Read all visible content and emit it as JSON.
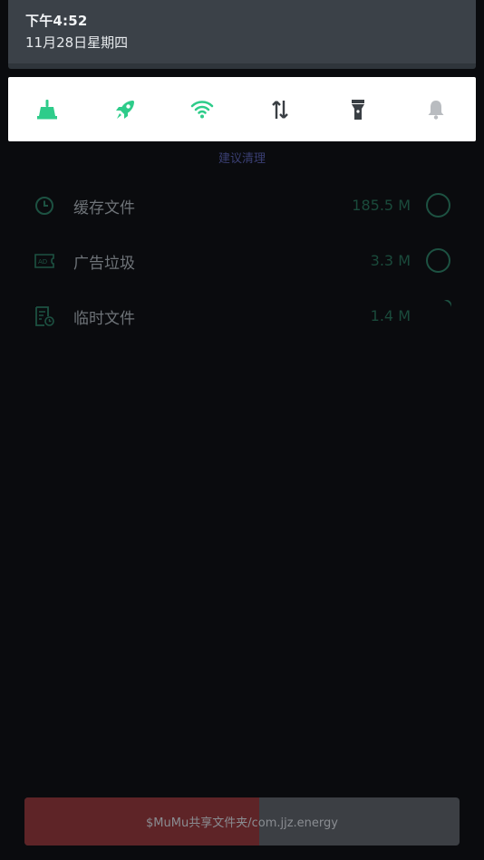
{
  "status": {
    "time": "下午4:52",
    "date": "11月28日星期四"
  },
  "quick_toggles": [
    {
      "name": "clean",
      "icon": "broom-icon",
      "color": "#2ecc8a"
    },
    {
      "name": "boost",
      "icon": "rocket-icon",
      "color": "#2ecc8a"
    },
    {
      "name": "wifi",
      "icon": "wifi-icon",
      "color": "#2ecc8a"
    },
    {
      "name": "data",
      "icon": "data-transfer-icon",
      "color": "#3a3f44"
    },
    {
      "name": "flashlight",
      "icon": "flashlight-icon",
      "color": "#3a3f44"
    },
    {
      "name": "sound",
      "icon": "bell-icon",
      "color": "#b9bcc0"
    }
  ],
  "suggestion": "建议清理",
  "junk_list": [
    {
      "label": "缓存文件",
      "size": "185.5 M",
      "icon": "clock-icon",
      "state": "unchecked"
    },
    {
      "label": "广告垃圾",
      "size": "3.3 M",
      "icon": "ad-icon",
      "state": "unchecked"
    },
    {
      "label": "临时文件",
      "size": "1.4 M",
      "icon": "temp-file-icon",
      "state": "scanning"
    }
  ],
  "bottom_bar": {
    "text": "$MuMu共享文件夹/com.jjz.energy",
    "progress": 0.54,
    "fill_color": "#5e2427",
    "track_color": "#3c3f44"
  },
  "colors": {
    "background": "#0a0b0e",
    "accent": "#2ecc8a",
    "list_accent": "#1d5242"
  }
}
